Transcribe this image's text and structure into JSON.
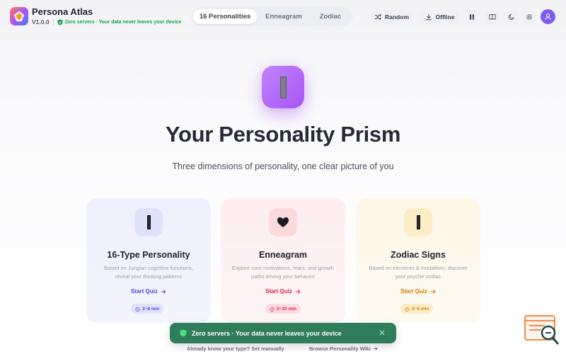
{
  "app": {
    "name": "Persona Atlas",
    "version": "V1.0.0",
    "privacy_note": "Zero servers · Your data never leaves your device"
  },
  "tabs": [
    {
      "label": "16 Personalities",
      "active": true
    },
    {
      "label": "Enneagram",
      "active": false
    },
    {
      "label": "Zodiac",
      "active": false
    }
  ],
  "toolbar": {
    "random_label": "Random",
    "offline_label": "Offline",
    "icons": [
      "shuffle-icon",
      "download-icon",
      "pause-icon",
      "book-icon",
      "moon-icon",
      "settings-icon",
      "user-icon"
    ]
  },
  "hero": {
    "title": "Your Personality Prism",
    "subtitle": "Three dimensions of personality, one clear picture of you"
  },
  "cards": [
    {
      "title": "16-Type Personality",
      "description": "Based on Jungian cognitive functions, reveal your thinking patterns",
      "cta": "Start Quiz",
      "duration": "3~8 min",
      "accent": "#4f46e5"
    },
    {
      "title": "Enneagram",
      "description": "Explore core motivations, fears, and growth paths driving your behavior",
      "cta": "Start Quiz",
      "duration": "5~10 min",
      "accent": "#e11d48"
    },
    {
      "title": "Zodiac Signs",
      "description": "Based on elements & modalities, discover your psyche zodiac",
      "cta": "Start Quiz",
      "duration": "3~5 min",
      "accent": "#d97706"
    }
  ],
  "toast": {
    "message": "Zero servers · Your data never leaves your device",
    "color": "#2f7d5b"
  },
  "footer": {
    "manual_link": "Already know your type? Set manually",
    "wiki_link": "Browse Personality Wiki"
  }
}
